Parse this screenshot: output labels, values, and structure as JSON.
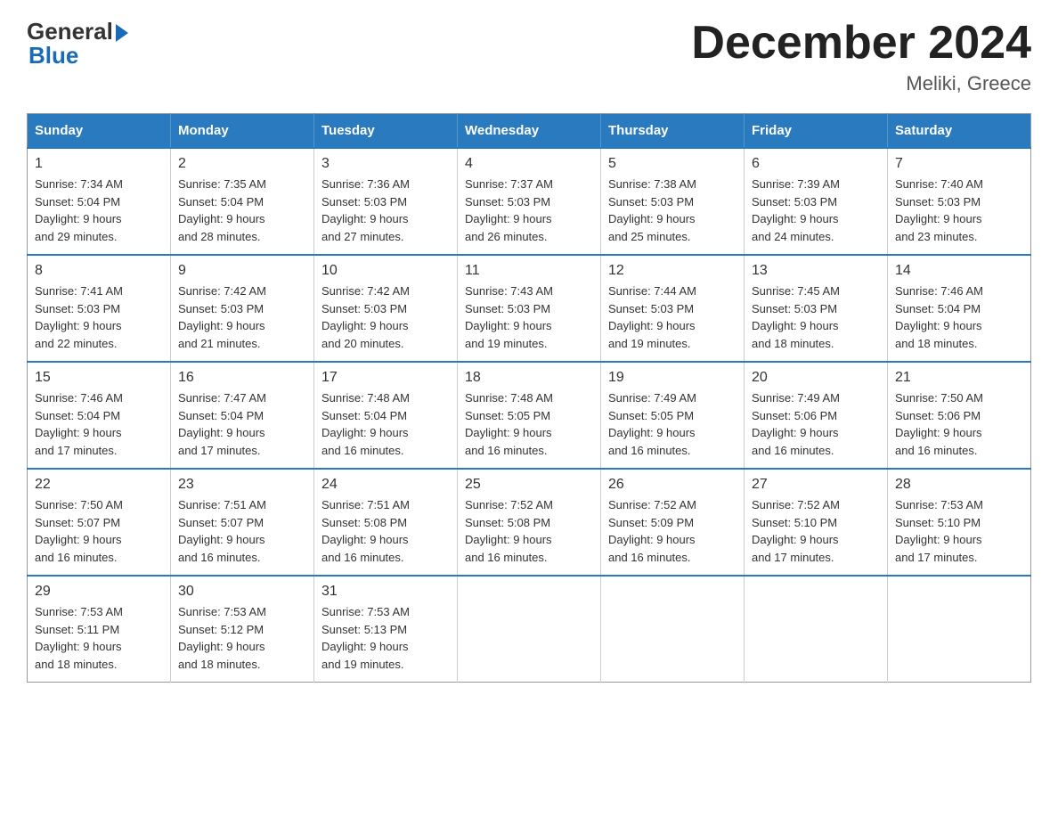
{
  "header": {
    "logo_general": "General",
    "logo_blue": "Blue",
    "month_title": "December 2024",
    "location": "Meliki, Greece"
  },
  "weekdays": [
    "Sunday",
    "Monday",
    "Tuesday",
    "Wednesday",
    "Thursday",
    "Friday",
    "Saturday"
  ],
  "weeks": [
    [
      {
        "day": "1",
        "sunrise": "7:34 AM",
        "sunset": "5:04 PM",
        "daylight": "9 hours and 29 minutes."
      },
      {
        "day": "2",
        "sunrise": "7:35 AM",
        "sunset": "5:04 PM",
        "daylight": "9 hours and 28 minutes."
      },
      {
        "day": "3",
        "sunrise": "7:36 AM",
        "sunset": "5:03 PM",
        "daylight": "9 hours and 27 minutes."
      },
      {
        "day": "4",
        "sunrise": "7:37 AM",
        "sunset": "5:03 PM",
        "daylight": "9 hours and 26 minutes."
      },
      {
        "day": "5",
        "sunrise": "7:38 AM",
        "sunset": "5:03 PM",
        "daylight": "9 hours and 25 minutes."
      },
      {
        "day": "6",
        "sunrise": "7:39 AM",
        "sunset": "5:03 PM",
        "daylight": "9 hours and 24 minutes."
      },
      {
        "day": "7",
        "sunrise": "7:40 AM",
        "sunset": "5:03 PM",
        "daylight": "9 hours and 23 minutes."
      }
    ],
    [
      {
        "day": "8",
        "sunrise": "7:41 AM",
        "sunset": "5:03 PM",
        "daylight": "9 hours and 22 minutes."
      },
      {
        "day": "9",
        "sunrise": "7:42 AM",
        "sunset": "5:03 PM",
        "daylight": "9 hours and 21 minutes."
      },
      {
        "day": "10",
        "sunrise": "7:42 AM",
        "sunset": "5:03 PM",
        "daylight": "9 hours and 20 minutes."
      },
      {
        "day": "11",
        "sunrise": "7:43 AM",
        "sunset": "5:03 PM",
        "daylight": "9 hours and 19 minutes."
      },
      {
        "day": "12",
        "sunrise": "7:44 AM",
        "sunset": "5:03 PM",
        "daylight": "9 hours and 19 minutes."
      },
      {
        "day": "13",
        "sunrise": "7:45 AM",
        "sunset": "5:03 PM",
        "daylight": "9 hours and 18 minutes."
      },
      {
        "day": "14",
        "sunrise": "7:46 AM",
        "sunset": "5:04 PM",
        "daylight": "9 hours and 18 minutes."
      }
    ],
    [
      {
        "day": "15",
        "sunrise": "7:46 AM",
        "sunset": "5:04 PM",
        "daylight": "9 hours and 17 minutes."
      },
      {
        "day": "16",
        "sunrise": "7:47 AM",
        "sunset": "5:04 PM",
        "daylight": "9 hours and 17 minutes."
      },
      {
        "day": "17",
        "sunrise": "7:48 AM",
        "sunset": "5:04 PM",
        "daylight": "9 hours and 16 minutes."
      },
      {
        "day": "18",
        "sunrise": "7:48 AM",
        "sunset": "5:05 PM",
        "daylight": "9 hours and 16 minutes."
      },
      {
        "day": "19",
        "sunrise": "7:49 AM",
        "sunset": "5:05 PM",
        "daylight": "9 hours and 16 minutes."
      },
      {
        "day": "20",
        "sunrise": "7:49 AM",
        "sunset": "5:06 PM",
        "daylight": "9 hours and 16 minutes."
      },
      {
        "day": "21",
        "sunrise": "7:50 AM",
        "sunset": "5:06 PM",
        "daylight": "9 hours and 16 minutes."
      }
    ],
    [
      {
        "day": "22",
        "sunrise": "7:50 AM",
        "sunset": "5:07 PM",
        "daylight": "9 hours and 16 minutes."
      },
      {
        "day": "23",
        "sunrise": "7:51 AM",
        "sunset": "5:07 PM",
        "daylight": "9 hours and 16 minutes."
      },
      {
        "day": "24",
        "sunrise": "7:51 AM",
        "sunset": "5:08 PM",
        "daylight": "9 hours and 16 minutes."
      },
      {
        "day": "25",
        "sunrise": "7:52 AM",
        "sunset": "5:08 PM",
        "daylight": "9 hours and 16 minutes."
      },
      {
        "day": "26",
        "sunrise": "7:52 AM",
        "sunset": "5:09 PM",
        "daylight": "9 hours and 16 minutes."
      },
      {
        "day": "27",
        "sunrise": "7:52 AM",
        "sunset": "5:10 PM",
        "daylight": "9 hours and 17 minutes."
      },
      {
        "day": "28",
        "sunrise": "7:53 AM",
        "sunset": "5:10 PM",
        "daylight": "9 hours and 17 minutes."
      }
    ],
    [
      {
        "day": "29",
        "sunrise": "7:53 AM",
        "sunset": "5:11 PM",
        "daylight": "9 hours and 18 minutes."
      },
      {
        "day": "30",
        "sunrise": "7:53 AM",
        "sunset": "5:12 PM",
        "daylight": "9 hours and 18 minutes."
      },
      {
        "day": "31",
        "sunrise": "7:53 AM",
        "sunset": "5:13 PM",
        "daylight": "9 hours and 19 minutes."
      },
      null,
      null,
      null,
      null
    ]
  ],
  "labels": {
    "sunrise": "Sunrise:",
    "sunset": "Sunset:",
    "daylight": "Daylight:"
  }
}
